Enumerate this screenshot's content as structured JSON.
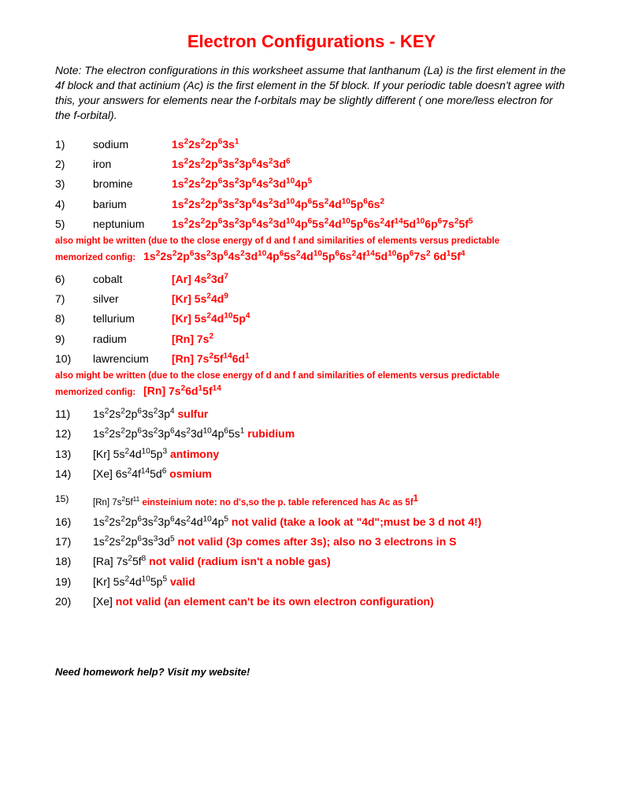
{
  "title": "Electron Configurations - KEY",
  "note": "Note:  The electron configurations in this worksheet assume that lanthanum (La) is the first element in the 4f block and that actinium (Ac) is the first element in the 5f block.  If your periodic table doesn't agree with this, your answers for elements near the f-orbitals may be slightly different ( one more/less electron for the  f-orbital).",
  "part1": [
    {
      "num": "1)",
      "name": "sodium",
      "config_segments": [
        "1s",
        "2",
        "2s",
        "2",
        "2p",
        "6",
        "3s",
        "1"
      ]
    },
    {
      "num": "2)",
      "name": "iron",
      "config_segments": [
        "1s",
        "2",
        "2s",
        "2",
        "2p",
        "6",
        "3s",
        "2",
        "3p",
        "6",
        "4s",
        "2",
        "3d",
        "6"
      ]
    },
    {
      "num": "3)",
      "name": "bromine",
      "config_segments": [
        "1s",
        "2",
        "2s",
        "2",
        "2p",
        "6",
        "3s",
        "2",
        "3p",
        "6",
        "4s",
        "2",
        "3d",
        "10",
        "4p",
        "5"
      ]
    },
    {
      "num": "4)",
      "name": "barium",
      "config_segments": [
        "1s",
        "2",
        "2s",
        "2",
        "2p",
        "6",
        "3s",
        "2",
        "3p",
        "6",
        "4s",
        "2",
        "3d",
        "10",
        "4p",
        "6",
        "5s",
        "2",
        "4d",
        "10",
        "5p",
        "6",
        "6s",
        "2"
      ]
    },
    {
      "num": "5)",
      "name": "neptunium",
      "config_segments": [
        "1s",
        "2",
        "2s",
        "2",
        "2p",
        "6",
        "3s",
        "2",
        "3p",
        "6",
        "4s",
        "2",
        "3d",
        "10",
        "4p",
        "6",
        "5s",
        "2",
        "4d",
        "10",
        "5p",
        "6",
        "6s",
        "2",
        "4f",
        "14",
        "5d",
        "10",
        "6p",
        "6",
        "7s",
        "2",
        "5f",
        "5"
      ]
    }
  ],
  "extra5_text": "also might be written (due to the close energy of d and f and similarities of elements versus predictable",
  "extra5_label": "memorized config:",
  "extra5_segments": [
    "1s",
    "2",
    "2s",
    "2",
    "2p",
    "6",
    "3s",
    "2",
    "3p",
    "6",
    "4s",
    "2",
    "3d",
    "10",
    "4p",
    "6",
    "5s",
    "2",
    "4d",
    "10",
    "5p",
    "6",
    "6s",
    "2",
    "4f",
    "14",
    "5d",
    "10",
    "6p",
    "6",
    "7s",
    "2",
    " 6d",
    "1",
    "5f",
    "4"
  ],
  "part2": [
    {
      "num": "6)",
      "name": "cobalt",
      "prefix": "[Ar]  ",
      "config_segments": [
        "4s",
        "2",
        "3d",
        "7"
      ]
    },
    {
      "num": "7)",
      "name": "silver",
      "prefix": "[Kr]  ",
      "config_segments": [
        "5s",
        "2",
        "4d",
        "9"
      ]
    },
    {
      "num": "8)",
      "name": "tellurium",
      "prefix": "[Kr]  ",
      "config_segments": [
        "5s",
        "2",
        "4d",
        "10",
        "5p",
        "4"
      ]
    },
    {
      "num": "9)",
      "name": "radium",
      "prefix": "[Rn]  ",
      "config_segments": [
        "7s",
        "2"
      ]
    },
    {
      "num": "10)",
      "name": "lawrencium",
      "prefix": "[Rn]  ",
      "config_segments": [
        "7s",
        "2",
        "5f",
        "14",
        "6d",
        "1"
      ]
    }
  ],
  "extra10_text": "also might be written (due to the close energy of d and f and similarities of elements versus predictable",
  "extra10_label": "memorized config:",
  "extra10_prefix": "[Rn]  ",
  "extra10_segments": [
    "7s",
    "2",
    "6d",
    "1",
    "5f",
    "14"
  ],
  "part3": [
    {
      "num": "11)",
      "black_segments": [
        "1s",
        "2",
        "2s",
        "2",
        "2p",
        "6",
        "3s",
        "2",
        "3p",
        "4"
      ],
      "red": "sulfur",
      "post_black": "",
      "post_note": ""
    },
    {
      "num": "12)",
      "black_segments": [
        "1s",
        "2",
        "2s",
        "2",
        "2p",
        "6",
        "3s",
        "2",
        "3p",
        "6",
        "4s",
        "2",
        "3d",
        "10",
        "4p",
        "6",
        "5s",
        "1"
      ],
      "red": "rubidium",
      "post_black": "",
      "post_note": ""
    },
    {
      "num": "13)",
      "black_prefix": "[Kr] ",
      "black_segments": [
        "5s",
        "2",
        "4d",
        "10",
        "5p",
        "3"
      ],
      "red": "antimony",
      "post_black": "",
      "post_note": ""
    },
    {
      "num": "14)",
      "black_prefix": "[Xe] ",
      "black_segments": [
        "6s",
        "2",
        "4f",
        "14",
        "5d",
        "6"
      ],
      "red": "osmium",
      "post_black": "",
      "post_note": ""
    },
    {
      "num": "15)",
      "sm": true,
      "black_prefix": "[Rn]  ",
      "black_segments": [
        "7s",
        "2",
        "5f",
        "11"
      ],
      "red": "einsteinium",
      "post_note": " note: no d's,so the p. table referenced has Ac  as 5f",
      "post_sup": "1"
    },
    {
      "num": "16)",
      "black_segments": [
        "1s",
        "2",
        "2s",
        "2",
        "2p",
        "6",
        "3s",
        "2",
        "3p",
        "6",
        "4s",
        "2",
        "4d",
        "10",
        "4p",
        "5"
      ],
      "red": "not valid",
      "red_tail": " (take a look at \"4d\";must be 3 d not 4!)"
    },
    {
      "num": "17)",
      "black_segments": [
        "1s",
        "2",
        "2s",
        "2",
        "2p",
        "6",
        "3s",
        "3",
        "3d",
        "5"
      ],
      "red": "not valid (3p comes after 3s);",
      "post_black": " also no 3 electrons in S"
    },
    {
      "num": "18)",
      "black_prefix": "[Ra] ",
      "black_segments": [
        "7s",
        "2",
        "5f",
        "8"
      ],
      "red": "not valid (radium isn't a noble gas)"
    },
    {
      "num": "19)",
      "black_prefix": "[Kr]  ",
      "black_segments": [
        "5s",
        "2",
        "4d",
        "10",
        "5p",
        "5"
      ],
      "red": "valid"
    },
    {
      "num": "20)",
      "black_prefix": "[Xe]  ",
      "black_segments": [],
      "red": "not valid (an element can't be its own electron configuration)"
    }
  ],
  "footer": "Need homework help?  Visit my website!"
}
